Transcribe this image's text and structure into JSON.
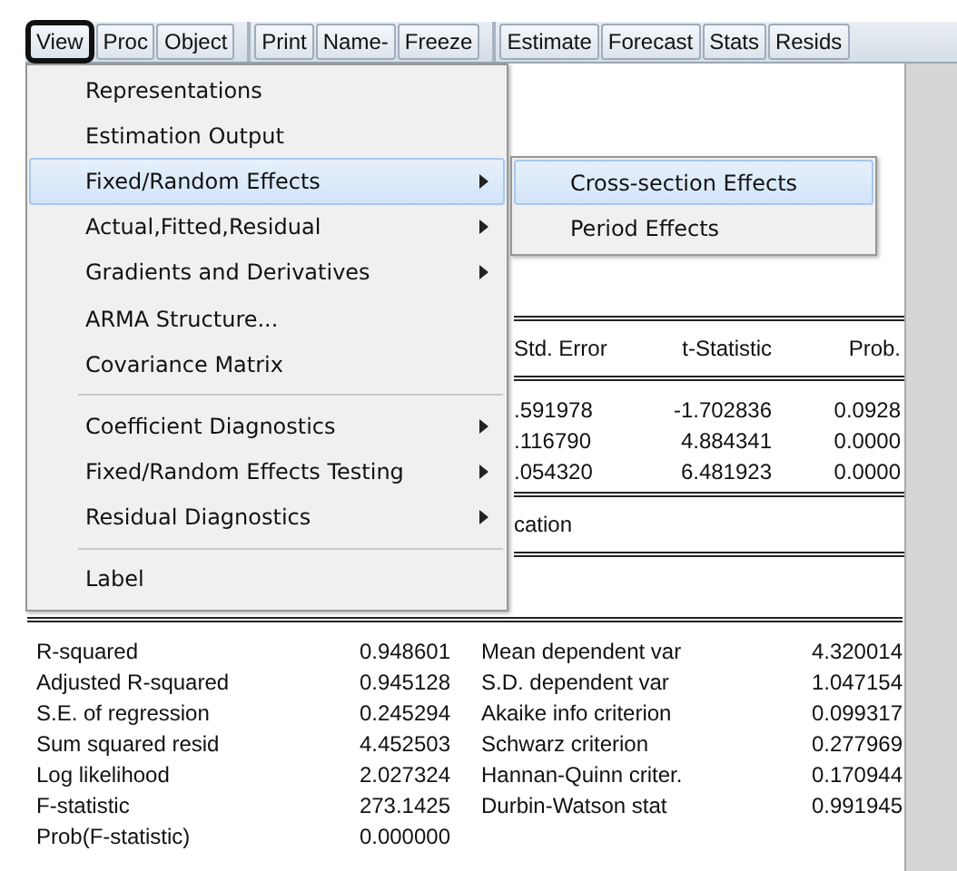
{
  "toolbar": {
    "groups": [
      [
        {
          "label": "View",
          "selected": true
        },
        {
          "label": "Proc",
          "selected": false
        },
        {
          "label": "Object",
          "selected": false
        }
      ],
      [
        {
          "label": "Print",
          "selected": false
        },
        {
          "label": "Name-",
          "selected": false
        },
        {
          "label": "Freeze",
          "selected": false
        }
      ],
      [
        {
          "label": "Estimate",
          "selected": false
        },
        {
          "label": "Forecast",
          "selected": false
        },
        {
          "label": "Stats",
          "selected": false
        },
        {
          "label": "Resids",
          "selected": false
        }
      ]
    ]
  },
  "coefficients": {
    "columns": [
      "Std. Error",
      "t-Statistic",
      "Prob."
    ],
    "rows": [
      [
        ".591978",
        "-1.702836",
        "0.0928"
      ],
      [
        ".116790",
        "4.884341",
        "0.0000"
      ],
      [
        ".054320",
        "6.481923",
        "0.0000"
      ]
    ],
    "section_label": "cation"
  },
  "statistics": [
    [
      "R-squared",
      "0.948601",
      "Mean dependent var",
      "4.320014"
    ],
    [
      "Adjusted R-squared",
      "0.945128",
      "S.D. dependent var",
      "1.047154"
    ],
    [
      "S.E. of regression",
      "0.245294",
      "Akaike info criterion",
      "0.099317"
    ],
    [
      "Sum squared resid",
      "4.452503",
      "Schwarz criterion",
      "0.277969"
    ],
    [
      "Log likelihood",
      "2.027324",
      "Hannan-Quinn criter.",
      "0.170944"
    ],
    [
      "F-statistic",
      "273.1425",
      "Durbin-Watson stat",
      "0.991945"
    ],
    [
      "Prob(F-statistic)",
      "0.000000"
    ]
  ],
  "menu": {
    "items": [
      {
        "kind": "item",
        "label": "Representations",
        "submenu": false,
        "selected": false
      },
      {
        "kind": "item",
        "label": "Estimation Output",
        "submenu": false,
        "selected": false
      },
      {
        "kind": "item",
        "label": "Fixed/Random Effects",
        "submenu": true,
        "selected": true
      },
      {
        "kind": "item",
        "label": "Actual,Fitted,Residual",
        "submenu": true,
        "selected": false
      },
      {
        "kind": "item",
        "label": "Gradients and Derivatives",
        "submenu": true,
        "selected": false
      },
      {
        "kind": "item",
        "label": "ARMA Structure...",
        "submenu": false,
        "selected": false
      },
      {
        "kind": "item",
        "label": "Covariance Matrix",
        "submenu": false,
        "selected": false
      },
      {
        "kind": "separator"
      },
      {
        "kind": "item",
        "label": "Coefficient Diagnostics",
        "submenu": true,
        "selected": false
      },
      {
        "kind": "item",
        "label": "Fixed/Random Effects Testing",
        "submenu": true,
        "selected": false
      },
      {
        "kind": "item",
        "label": "Residual Diagnostics",
        "submenu": true,
        "selected": false
      },
      {
        "kind": "separator"
      },
      {
        "kind": "item",
        "label": "Label",
        "submenu": false,
        "selected": false
      }
    ]
  },
  "submenu": {
    "items": [
      {
        "label": "Cross-section Effects",
        "selected": true
      },
      {
        "label": "Period Effects",
        "selected": false
      }
    ]
  }
}
